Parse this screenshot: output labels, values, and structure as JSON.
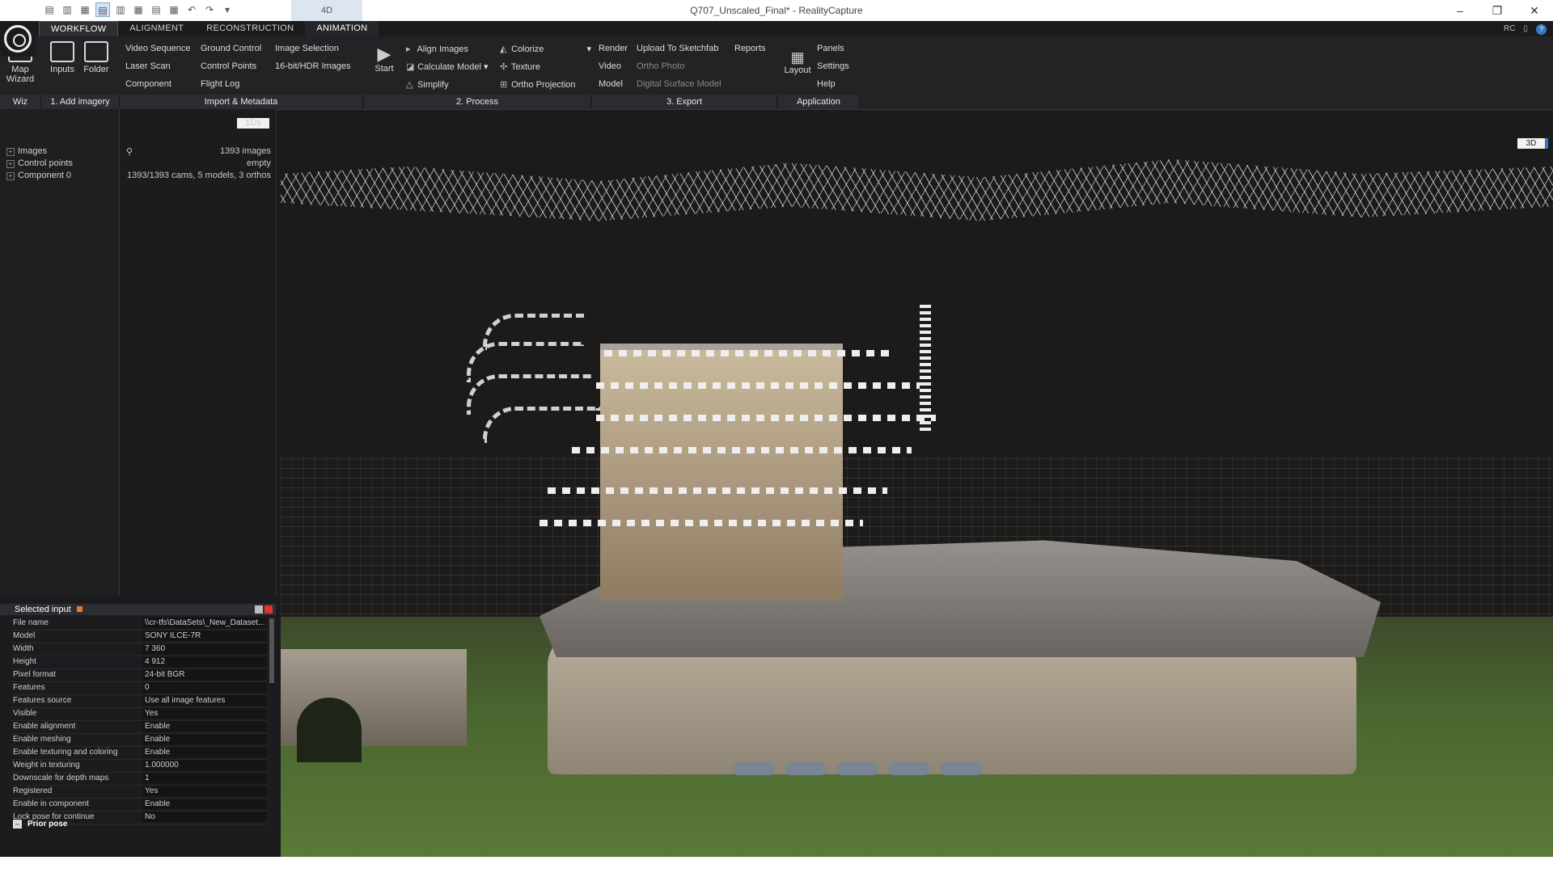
{
  "window": {
    "title": "Q707_Unscaled_Final* - RealityCapture",
    "tab_4d": "4D",
    "controls": [
      "–",
      "❐",
      "✕"
    ]
  },
  "ribbon_tabs": [
    "WORKFLOW",
    "ALIGNMENT",
    "RECONSTRUCTION",
    "ANIMATION"
  ],
  "top_right": {
    "rc": "RC",
    "help": "?"
  },
  "ribbon": {
    "map_wizard": "Map\nWizard",
    "inputs": "Inputs",
    "folder": "Folder",
    "video_sequence": "Video Sequence",
    "laser_scan": "Laser Scan",
    "component": "Component",
    "ground_control": "Ground Control",
    "control_points": "Control Points",
    "flight_log": "Flight Log",
    "image_selection": "Image Selection",
    "hdr_images": "16-bit/HDR Images",
    "start": "Start",
    "align_images": "Align Images",
    "calculate_model": "Calculate Model",
    "simplify": "Simplify",
    "colorize": "Colorize",
    "texture": "Texture",
    "ortho_projection": "Ortho Projection",
    "render": "Render",
    "video": "Video",
    "model": "Model",
    "upload_sketchfab": "Upload To Sketchfab",
    "ortho_photo": "Ortho Photo",
    "digital_surface_model": "Digital Surface Model",
    "reports": "Reports",
    "layout": "Layout",
    "panels": "Panels",
    "settings": "Settings",
    "help": "Help"
  },
  "groups": [
    "Wiz",
    "1. Add imagery",
    "Import & Metadata",
    "2. Process",
    "3. Export",
    "Application"
  ],
  "tree": {
    "images": "Images",
    "control_points": "Control points",
    "component": "Component 0"
  },
  "info": {
    "chip": "1Ds",
    "images": "1393 images",
    "control_points": "empty",
    "component": "1393/1393 cams, 5 models, 3 orthos"
  },
  "selected_input": {
    "title": "Selected input",
    "rows": [
      {
        "k": "File name",
        "v": "\\\\cr-tfs\\DataSets\\_New_Dataset..."
      },
      {
        "k": "Model",
        "v": "SONY ILCE-7R"
      },
      {
        "k": "Width",
        "v": "7 360"
      },
      {
        "k": "Height",
        "v": "4 912"
      },
      {
        "k": "Pixel format",
        "v": "24-bit BGR"
      },
      {
        "k": "Features",
        "v": "0"
      },
      {
        "k": "Features source",
        "v": "Use all image features"
      },
      {
        "k": "Visible",
        "v": "Yes"
      },
      {
        "k": "Enable alignment",
        "v": "Enable"
      },
      {
        "k": "Enable meshing",
        "v": "Enable"
      },
      {
        "k": "Enable texturing and coloring",
        "v": "Enable"
      },
      {
        "k": "Weight in texturing",
        "v": "1.000000"
      },
      {
        "k": "Downscale for depth maps",
        "v": "1"
      },
      {
        "k": "Registered",
        "v": "Yes"
      },
      {
        "k": "Enable in component",
        "v": "Enable"
      },
      {
        "k": "Lock pose for continue",
        "v": "No"
      }
    ],
    "prior_pose": "Prior pose"
  },
  "viewport": {
    "mode": "3D"
  },
  "colors": {
    "accent": "#3a78c8",
    "panel": "#1b1b1d",
    "ribbon": "#232326"
  }
}
